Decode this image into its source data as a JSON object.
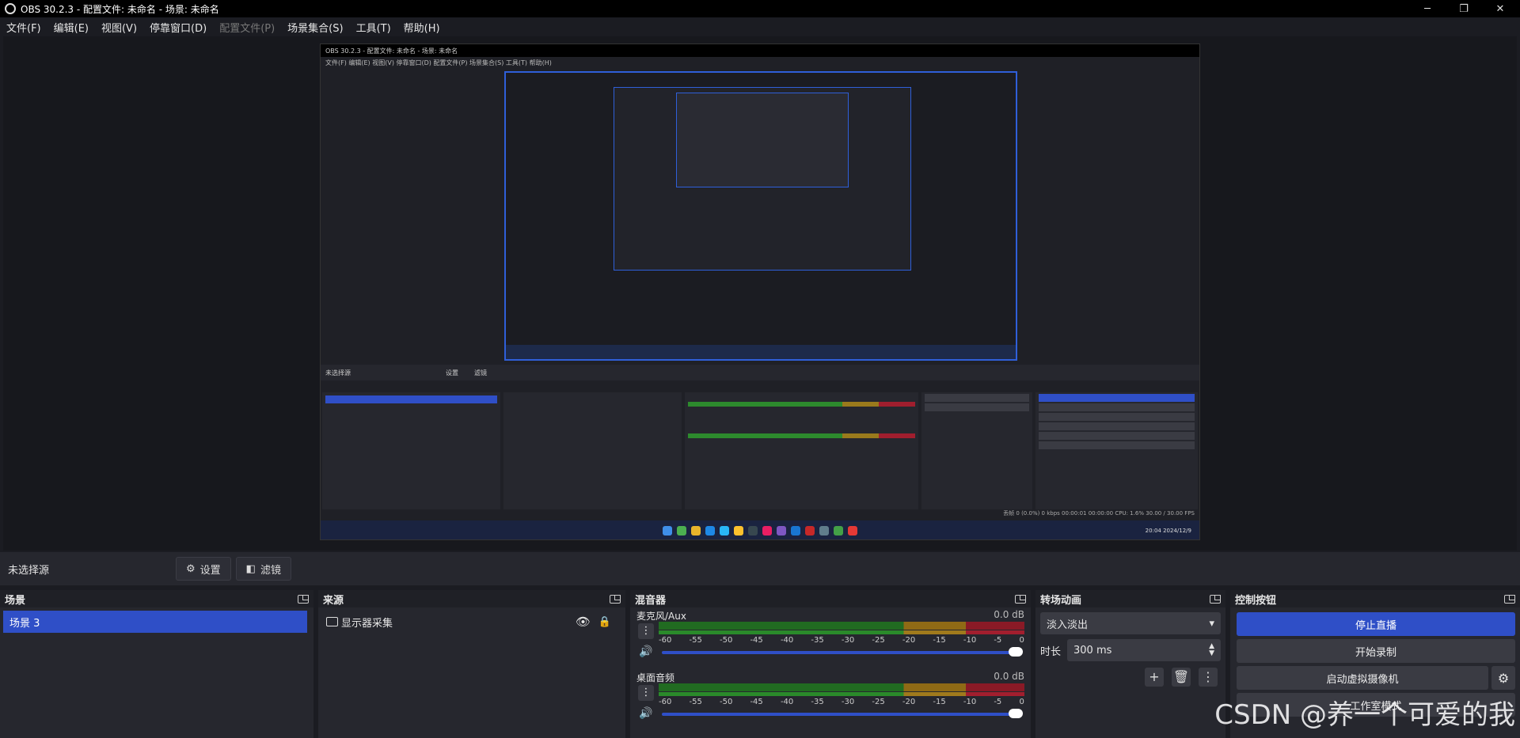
{
  "window": {
    "title": "OBS 30.2.3 - 配置文件: 未命名 - 场景: 未命名",
    "controls": {
      "minimize": "─",
      "maximize": "❐",
      "close": "✕"
    }
  },
  "menu": [
    {
      "label": "文件(F)",
      "disabled": false
    },
    {
      "label": "编辑(E)",
      "disabled": false
    },
    {
      "label": "视图(V)",
      "disabled": false
    },
    {
      "label": "停靠窗口(D)",
      "disabled": false
    },
    {
      "label": "配置文件(P)",
      "disabled": true
    },
    {
      "label": "场景集合(S)",
      "disabled": false
    },
    {
      "label": "工具(T)",
      "disabled": false
    },
    {
      "label": "帮助(H)",
      "disabled": false
    }
  ],
  "nested": {
    "title": "OBS 30.2.3 - 配置文件: 未命名 - 场景: 未命名",
    "menu": "文件(F)  编辑(E)  视图(V)  停靠窗口(D)  配置文件(P)  场景集合(S)  工具(T)  帮助(H)",
    "sourcebar": "未选择源",
    "settings": "设置",
    "filters": "滤镜",
    "status": "丢帧 0 (0.0%)   0 kbps   00:00:01   00:00:00   CPU: 1.6%   30.00 / 30.00 FPS",
    "clock_time": "20:04",
    "clock_date": "2024/12/9"
  },
  "sourcebar": {
    "label": "未选择源",
    "settings_button": "设置",
    "filters_button": "滤镜"
  },
  "scenes": {
    "title": "场景",
    "items": [
      "场景 3"
    ]
  },
  "sources": {
    "title": "来源",
    "items": [
      "显示器采集"
    ]
  },
  "mixer": {
    "title": "混音器",
    "scale": [
      "-60",
      "-55",
      "-50",
      "-45",
      "-40",
      "-35",
      "-30",
      "-25",
      "-20",
      "-15",
      "-10",
      "-5",
      "0"
    ],
    "channels": [
      {
        "name": "麦克风/Aux",
        "db": "0.0 dB"
      },
      {
        "name": "桌面音频",
        "db": "0.0 dB"
      }
    ]
  },
  "transitions": {
    "title": "转场动画",
    "selected": "淡入淡出",
    "duration_label": "时长",
    "duration_value": "300 ms"
  },
  "controls": {
    "title": "控制按钮",
    "stop_stream": "停止直播",
    "start_record": "开始录制",
    "virtual_cam": "启动虚拟摄像机",
    "studio_mode": "工作室模式"
  },
  "watermark": "CSDN @养一个可爱的我",
  "colors": {
    "accent": "#2f4fc7",
    "panel": "#26272e",
    "background": "#1b1c22"
  }
}
